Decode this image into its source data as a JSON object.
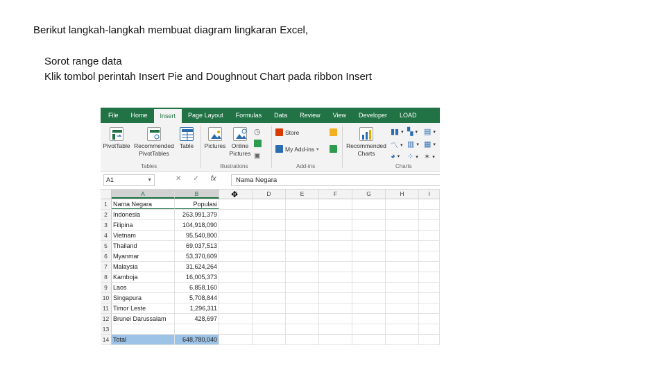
{
  "slide": {
    "title": "Berikut langkah-langkah membuat diagram lingkaran Excel,",
    "steps": [
      "Sorot range data",
      "Klik tombol perintah Insert Pie and Doughnout Chart pada ribbon Insert"
    ]
  },
  "excel": {
    "tabs": [
      "File",
      "Home",
      "Insert",
      "Page Layout",
      "Formulas",
      "Data",
      "Review",
      "View",
      "Developer",
      "LOAD"
    ],
    "active_tab": "Insert",
    "ribbon": {
      "tables": {
        "pivot_table": "PivotTable",
        "recommended_pivot": "Recommended PivotTables",
        "table": "Table",
        "label": "Tables"
      },
      "illustrations": {
        "pictures": "Pictures",
        "online_pictures": "Online Pictures",
        "label": "Illustrations"
      },
      "addins": {
        "store": "Store",
        "my_addins": "My Add-ins",
        "label": "Add-ins"
      },
      "charts": {
        "recommended_charts": "Recommended Charts",
        "label": "Charts"
      }
    },
    "formula_bar": {
      "name_box": "A1",
      "value": "Nama Negara"
    },
    "columns": [
      "A",
      "B",
      "C",
      "D",
      "E",
      "F",
      "G",
      "H",
      "I"
    ],
    "rows": [
      {
        "n": "1",
        "a": "Nama Negara",
        "b": "Populasi"
      },
      {
        "n": "2",
        "a": "Indonesia",
        "b": "263,991,379"
      },
      {
        "n": "3",
        "a": "Filipina",
        "b": "104,918,090"
      },
      {
        "n": "4",
        "a": "Vietnam",
        "b": "95,540,800"
      },
      {
        "n": "5",
        "a": "Thailand",
        "b": "69,037,513"
      },
      {
        "n": "6",
        "a": "Myanmar",
        "b": "53,370,609"
      },
      {
        "n": "7",
        "a": "Malaysia",
        "b": "31,624,264"
      },
      {
        "n": "8",
        "a": "Kamboja",
        "b": "16,005,373"
      },
      {
        "n": "9",
        "a": "Laos",
        "b": "6,858,160"
      },
      {
        "n": "10",
        "a": "Singapura",
        "b": "5,708,844"
      },
      {
        "n": "11",
        "a": "Timor Leste",
        "b": "1,296,311"
      },
      {
        "n": "12",
        "a": "Brunei Darussalam",
        "b": "428,697"
      },
      {
        "n": "13",
        "a": "",
        "b": ""
      },
      {
        "n": "14",
        "a": "Total",
        "b": "648,780,040"
      }
    ],
    "colors": {
      "excel_green": "#217346",
      "selection_blue": "#9dc3e6"
    }
  }
}
